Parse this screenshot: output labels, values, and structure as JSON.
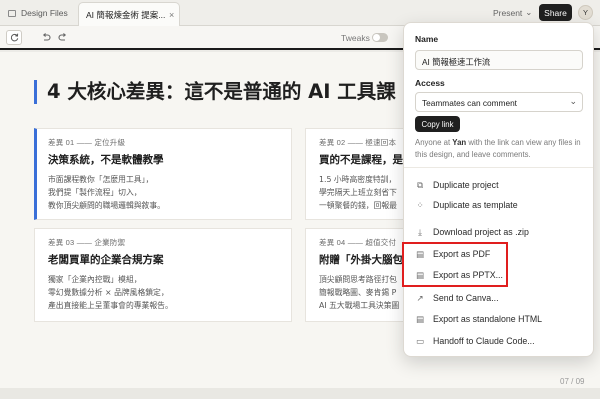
{
  "tabs": [
    {
      "label": "Design Files"
    },
    {
      "label": "AI 簡報煉金術 提案...",
      "close": "×"
    }
  ],
  "header": {
    "present_label": "Present",
    "present_chevron": "⌄",
    "share_label": "Share",
    "avatar_initial": "Y"
  },
  "toolbar": {
    "tweaks_label": "Tweaks",
    "tweaks_on": false,
    "icons": [
      "refresh-icon",
      "undo-icon",
      "redo-icon"
    ]
  },
  "slide": {
    "title": "4 大核心差異：這不是普通的 AI 工具課",
    "accent_color": "#3a6fd8",
    "cards": [
      {
        "tag": "差異 01 —— 定位升級",
        "head": "決策系統，不是軟體教學",
        "lines": [
          "市面課程教你「怎麼用工具」，",
          "我們提「製作流程」切入，",
          "教你頂尖顧問的職場邏輯與敘事。"
        ]
      },
      {
        "tag": "差異 02 —— 極速回本",
        "head": "買的不是課程，是價",
        "lines": [
          "1.5 小時高密度特訓，",
          "學完隔天上班立刻省下",
          "一頓聚餐的錢，回報最"
        ]
      },
      {
        "tag": "差異 03 —— 企業防禦",
        "head": "老闆買單的企業合規方案",
        "lines": [
          "獨家「企業內控戰」模組，",
          "零幻覺數據分析 × 品牌風格鎖定，",
          "產出直接能上呈董事會的專業報告。"
        ]
      },
      {
        "tag": "差異 04 —— 超值交付",
        "head": "附贈「外掛大腦包",
        "lines": [
          "頂尖顧問思考路徑打包",
          "簡報戰略圖、麥肯錫 P",
          "AI 五大戰場工具決策圖"
        ]
      }
    ],
    "page_number": "07 / 09"
  },
  "share_panel": {
    "name_label": "Name",
    "name_value": "AI 簡報極速工作流",
    "access_label": "Access",
    "access_value": "Teammates can comment",
    "copy_link_label": "Copy link",
    "note_prefix": "Anyone at",
    "note_org": "Yan",
    "note_suffix": "with the link can view any files in this design, and leave comments.",
    "menu": [
      {
        "label": "Duplicate project",
        "icon": "copy-icon"
      },
      {
        "label": "Duplicate as template",
        "icon": "template-icon"
      },
      {
        "label": "Download project as .zip",
        "icon": "download-icon"
      },
      {
        "label": "Export as PDF",
        "icon": "file-icon"
      },
      {
        "label": "Export as PPTX...",
        "icon": "file-icon"
      },
      {
        "label": "Send to Canva...",
        "icon": "external-link-icon"
      },
      {
        "label": "Export as standalone HTML",
        "icon": "file-icon"
      },
      {
        "label": "Handoff to Claude Code...",
        "icon": "terminal-icon"
      }
    ],
    "highlight_color": "#e01e1e"
  }
}
